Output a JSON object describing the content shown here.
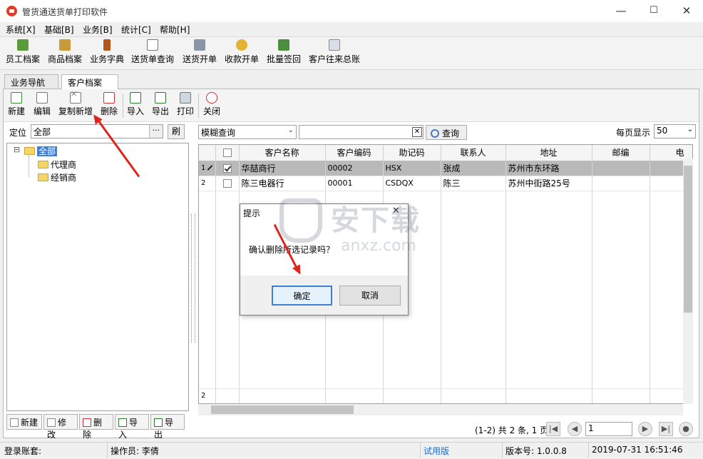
{
  "window": {
    "title": "管货通送货单打印软件",
    "minimize": "—",
    "maximize": "☐",
    "close": "✕"
  },
  "menu": [
    "系统[X]",
    "基础[B]",
    "业务[B]",
    "统计[C]",
    "帮助[H]"
  ],
  "toolbar": [
    "员工档案",
    "商品档案",
    "业务字典",
    "送货单查询",
    "送货开单",
    "收款开单",
    "批量签回",
    "客户往来总账"
  ],
  "tabs": [
    {
      "label": "业务导航"
    },
    {
      "label": "客户档案",
      "close": "✕"
    }
  ],
  "subtoolbar": [
    "新建",
    "编辑",
    "复制新增",
    "删除",
    "导入",
    "导出",
    "打印",
    "关闭"
  ],
  "locate": {
    "label": "定位",
    "value": "全部",
    "dots": "···",
    "refresh": "刷"
  },
  "tree": {
    "root": "全部",
    "children": [
      "代理商",
      "经销商"
    ],
    "expander": "⊟"
  },
  "search": {
    "mode": "模糊查询",
    "value": "",
    "query_label": "查询",
    "clear": "✕"
  },
  "page_size": {
    "label": "每页显示",
    "value": "50"
  },
  "grid": {
    "columns": [
      "客户名称",
      "客户编码",
      "助记码",
      "联系人",
      "地址",
      "邮编",
      "电"
    ],
    "rows": [
      {
        "num": "1",
        "checked": true,
        "name": "华喆商行",
        "code": "00002",
        "mnemonic": "HSX",
        "contact": "张成",
        "address": "苏州市东环路"
      },
      {
        "num": "2",
        "checked": false,
        "name": "陈三电器行",
        "code": "00001",
        "mnemonic": "CSDQX",
        "contact": "陈三",
        "address": "苏州中街路25号"
      }
    ],
    "footer_num": "2"
  },
  "left_buttons": [
    "新建",
    "修改",
    "删除",
    "导入",
    "导出"
  ],
  "pager": {
    "summary": "(1-2) 共 2 条, 1 页",
    "page": "1"
  },
  "dialog": {
    "title": "提示",
    "message": "确认删除所选记录吗？",
    "ok": "确定",
    "cancel": "取消",
    "close": "✕"
  },
  "watermark": {
    "text": "安下载",
    "url": "anxz.com"
  },
  "status": {
    "account": "登录账套:",
    "operator": "操作员: 李倩",
    "trial": "试用版",
    "version": "版本号: 1.0.0.8",
    "datetime": "2019-07-31  16:51:46"
  },
  "colors": {
    "accent": "#e0231c",
    "selected_row": "#b9b9b9",
    "trial": "#1a6fc9"
  }
}
